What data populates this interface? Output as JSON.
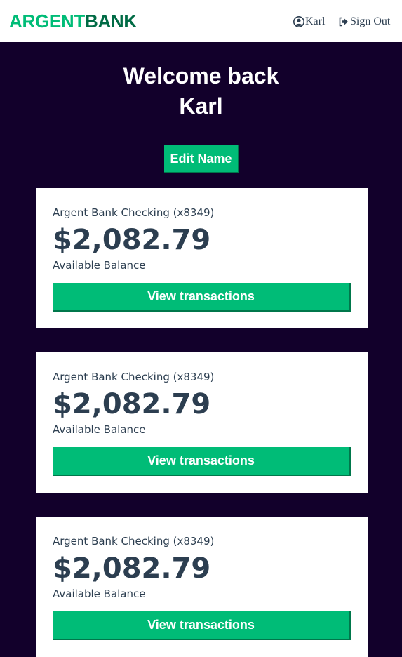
{
  "brand": {
    "part1": "ARGENT",
    "part2": "BANK",
    "part1_color": "#00bc77",
    "part2_color": "#006b45"
  },
  "nav": {
    "user_label": "Karl",
    "user_icon": "user-circle-icon",
    "signout_label": "Sign Out",
    "signout_icon": "sign-out-icon"
  },
  "header": {
    "welcome_line1": "Welcome back",
    "welcome_line2": "Karl",
    "edit_button_label": "Edit Name"
  },
  "accounts": [
    {
      "title": "Argent Bank Checking (x8349)",
      "amount": "$2,082.79",
      "description": "Available Balance",
      "button_label": "View transactions"
    },
    {
      "title": "Argent Bank Checking (x8349)",
      "amount": "$2,082.79",
      "description": "Available Balance",
      "button_label": "View transactions"
    },
    {
      "title": "Argent Bank Checking (x8349)",
      "amount": "$2,082.79",
      "description": "Available Balance",
      "button_label": "View transactions"
    }
  ],
  "colors": {
    "background": "#12002b",
    "accent": "#00bc77",
    "text": "#2c3e50"
  }
}
